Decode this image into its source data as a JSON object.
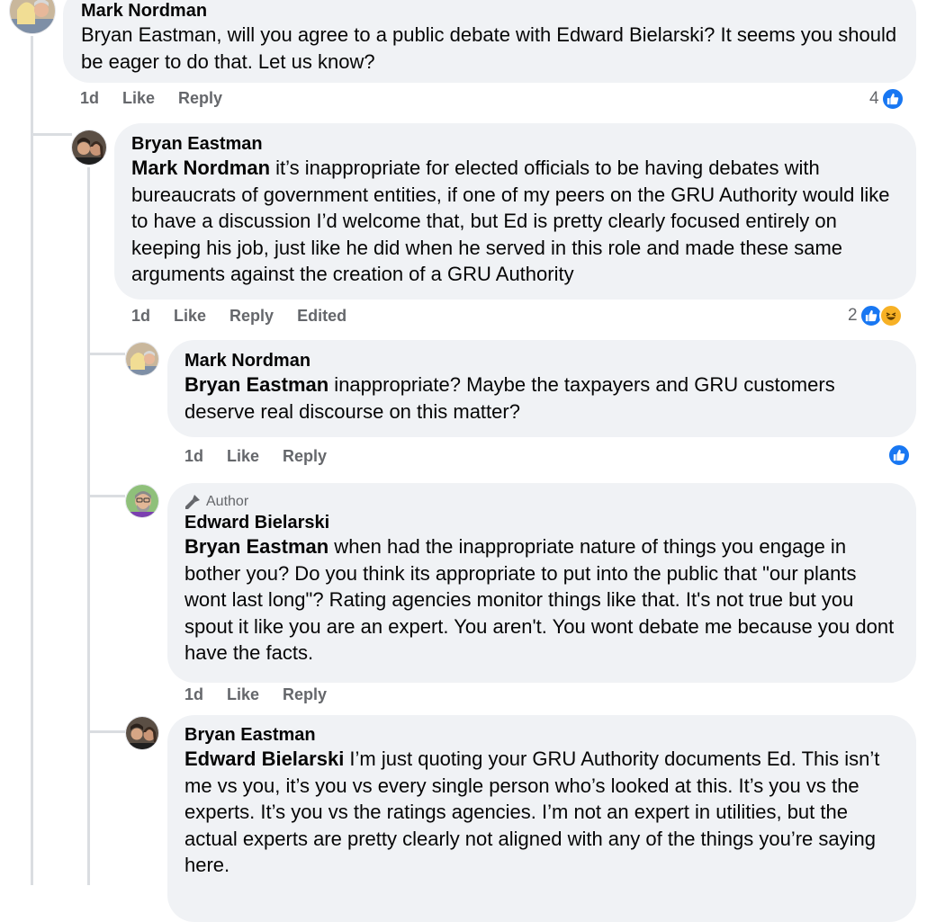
{
  "comments": [
    {
      "author": "Mark Nordman",
      "mention": "",
      "text": "Bryan Eastman, will you agree to a public debate with Edward Bielarski? It seems you should be eager to do that. Let us know?",
      "meta": {
        "time": "1d",
        "like": "Like",
        "reply": "Reply"
      },
      "reactions": {
        "count": "4",
        "types": [
          "like"
        ]
      }
    },
    {
      "author": "Bryan Eastman",
      "mention": "Mark Nordman",
      "text": " it’s inappropriate for elected officials to be having debates with bureaucrats of government entities, if one of my peers on the GRU Authority would like to have a discussion I’d welcome that, but Ed is pretty clearly focused entirely on keeping his job, just like he did when he served in this role and made these same arguments against the creation of a GRU Authority",
      "meta": {
        "time": "1d",
        "like": "Like",
        "reply": "Reply",
        "edited": "Edited"
      },
      "reactions": {
        "count": "2",
        "types": [
          "like",
          "haha"
        ]
      }
    },
    {
      "author": "Mark Nordman",
      "mention": "Bryan Eastman",
      "text": " inappropriate? Maybe the taxpayers and GRU customers deserve real discourse on this matter?",
      "meta": {
        "time": "1d",
        "like": "Like",
        "reply": "Reply"
      },
      "reactions": {
        "count": "",
        "types": [
          "like"
        ]
      }
    },
    {
      "badge": "Author",
      "author": "Edward Bielarski",
      "mention": "Bryan Eastman",
      "text": " when had the inappropriate nature of things you engage in bother you? Do you think its appropriate to put into the public that \"our plants wont last long\"? Rating agencies monitor things like that. It's not true but you spout it like you are an expert. You aren't. You wont debate me because you dont have the facts.",
      "meta": {
        "time": "1d",
        "like": "Like",
        "reply": "Reply"
      }
    },
    {
      "author": "Bryan Eastman",
      "mention": "Edward Bielarski",
      "text": " I’m just quoting your GRU Authority documents Ed. This isn’t me vs you, it’s you vs every single person who’s looked at this. It’s you vs the experts. It’s you vs the ratings agencies. I’m not an expert in utilities, but the actual experts are pretty clearly not aligned with any of the things you’re saying here."
    }
  ],
  "colors": {
    "like_blue": "#1877f2",
    "bubble_bg": "#f0f2f5",
    "meta_gray": "#65676b",
    "thread_line": "#dadde1"
  }
}
